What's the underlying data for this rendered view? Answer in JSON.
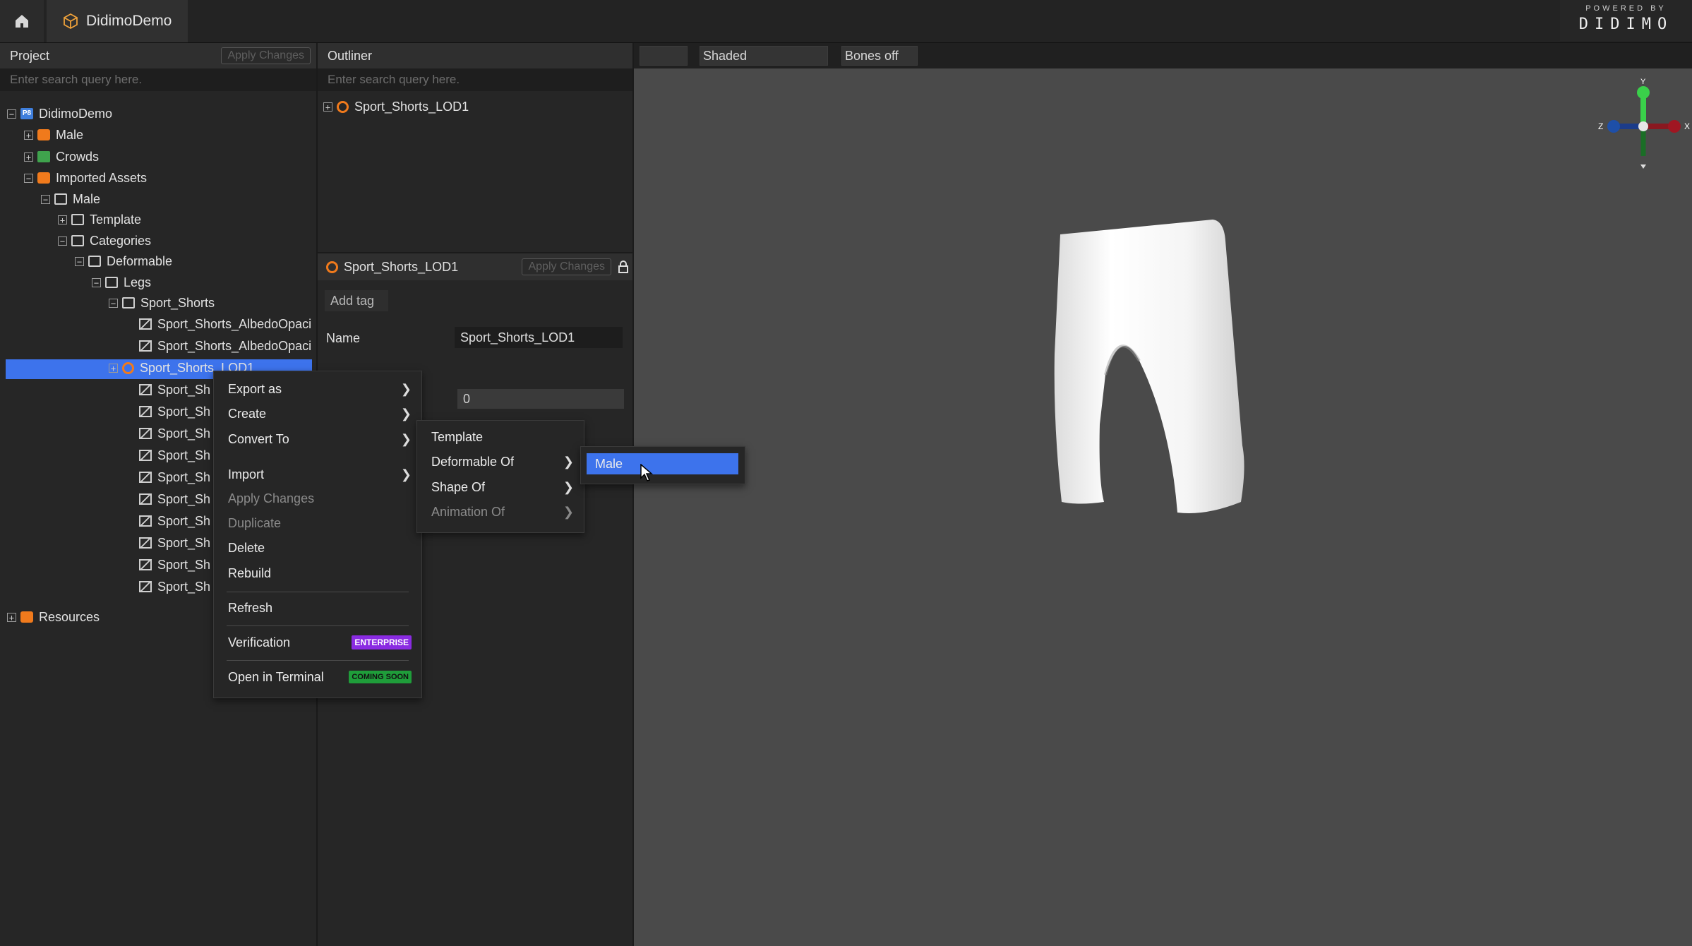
{
  "app": {
    "tab_title": "DidimoDemo",
    "logo_small": "POWERED BY",
    "logo_big": "DIDIMO"
  },
  "project": {
    "title": "Project",
    "apply_label": "Apply Changes",
    "search_placeholder": "Enter search query here.",
    "tree": [
      {
        "label": "DidimoDemo",
        "icon": "project-icon",
        "exp": "−"
      },
      {
        "label": "Male",
        "icon": "character-icon",
        "exp": "+"
      },
      {
        "label": "Crowds",
        "icon": "crowd-icon",
        "exp": "+"
      },
      {
        "label": "Imported Assets",
        "icon": "assets-icon",
        "exp": "−"
      },
      {
        "label": "Male",
        "icon": "folder-icon",
        "exp": "−"
      },
      {
        "label": "Template",
        "icon": "folder-icon",
        "exp": "+"
      },
      {
        "label": "Categories",
        "icon": "folder-icon",
        "exp": "−"
      },
      {
        "label": "Deformable",
        "icon": "folder-icon",
        "exp": "−"
      },
      {
        "label": "Legs",
        "icon": "folder-icon",
        "exp": "−"
      },
      {
        "label": "Sport_Shorts",
        "icon": "folder-icon",
        "exp": "−"
      },
      {
        "label": "Sport_Shorts_AlbedoOpaci",
        "icon": "texture-icon",
        "exp": ""
      },
      {
        "label": "Sport_Shorts_AlbedoOpaci",
        "icon": "texture-icon",
        "exp": ""
      },
      {
        "label": "Sport_Shorts_LOD1",
        "icon": "mesh-icon",
        "exp": "+"
      },
      {
        "label": "Sport_Sh",
        "icon": "texture-icon",
        "exp": ""
      },
      {
        "label": "Sport_Sh",
        "icon": "texture-icon",
        "exp": ""
      },
      {
        "label": "Sport_Sh",
        "icon": "texture-icon",
        "exp": ""
      },
      {
        "label": "Sport_Sh",
        "icon": "texture-icon",
        "exp": ""
      },
      {
        "label": "Sport_Sh",
        "icon": "texture-icon",
        "exp": ""
      },
      {
        "label": "Sport_Sh",
        "icon": "texture-icon",
        "exp": ""
      },
      {
        "label": "Sport_Sh",
        "icon": "texture-icon",
        "exp": ""
      },
      {
        "label": "Sport_Sh",
        "icon": "texture-icon",
        "exp": ""
      },
      {
        "label": "Sport_Sh",
        "icon": "texture-icon",
        "exp": ""
      },
      {
        "label": "Sport_Sh",
        "icon": "texture-icon",
        "exp": ""
      },
      {
        "label": "Resources",
        "icon": "resources-icon",
        "exp": "+"
      }
    ]
  },
  "outliner": {
    "title": "Outliner",
    "search_placeholder": "Enter search query here.",
    "item": "Sport_Shorts_LOD1"
  },
  "inspector": {
    "asset_name": "Sport_Shorts_LOD1",
    "apply_label": "Apply Changes",
    "add_tag": "Add tag",
    "name_label": "Name",
    "name_value": "Sport_Shorts_LOD1",
    "number_value": "0"
  },
  "viewport": {
    "shading": "Shaded",
    "bones": "Bones off",
    "gizmo": {
      "y": "Y",
      "x": "X",
      "z": "Z"
    }
  },
  "context_menu": {
    "items": [
      "Export as",
      "Create",
      "Convert To",
      "Import",
      "Apply Changes",
      "Duplicate",
      "Delete",
      "Rebuild",
      "Refresh",
      "Verification",
      "Open in Terminal"
    ],
    "badge_enterprise": "ENTERPRISE",
    "badge_coming": "COMING SOON"
  },
  "convert_menu": {
    "items": [
      "Template",
      "Deformable Of",
      "Shape Of",
      "Animation Of"
    ]
  },
  "deformable_menu": {
    "items": [
      "Male"
    ]
  },
  "colors": {
    "selection": "#3d73ec",
    "accent_orange": "#f07a1c",
    "enterprise": "#8a2be2",
    "coming_soon": "#1f9d3a"
  }
}
